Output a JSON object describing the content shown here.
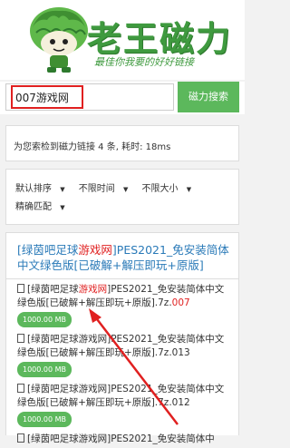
{
  "header": {
    "logo_title": "老王磁力",
    "logo_slogan": "最佳你我要的好好链接"
  },
  "search": {
    "query": "007游戏网",
    "button_label": "磁力搜索"
  },
  "summary": {
    "text": "为您索检到磁力链接 4 条, 耗时: 18ms"
  },
  "filters": {
    "sort": "默认排序",
    "time": "不限时间",
    "size": "不限大小",
    "match": "精确匹配"
  },
  "result": {
    "title_pre": "[绿茵吧足球",
    "title_hl": "游戏网",
    "title_post": "]PES2021_免安装简体中文绿色版[已破解+解压即玩+原版]",
    "files": [
      {
        "pre": "[绿茵吧足球",
        "hl": "游戏网",
        "post": "]PES2021_免安装简体中文绿色版[已破解+解压即玩+原版].7z.",
        "ext_hl": "007",
        "size": "1000.00 MB"
      },
      {
        "pre": "[绿茵吧足球游戏网]PES2021_免安装简体中文绿色版[已破解+解压即玩+原版].7z.013",
        "hl": "",
        "post": "",
        "ext_hl": "",
        "size": "1000.00 MB"
      },
      {
        "pre": "[绿茵吧足球游戏网]PES2021_免安装简体中文绿色版[已破解+解压即玩+原版].7z.012",
        "hl": "",
        "post": "",
        "ext_hl": "",
        "size": "1000.00 MB"
      },
      {
        "pre": "[绿茵吧足球游戏网]PES2021_免安装简体中",
        "hl": "",
        "post": "",
        "ext_hl": "",
        "size": ""
      }
    ]
  },
  "colors": {
    "accent": "#5cb85c",
    "link": "#2a7ab8",
    "highlight": "#e02020"
  }
}
